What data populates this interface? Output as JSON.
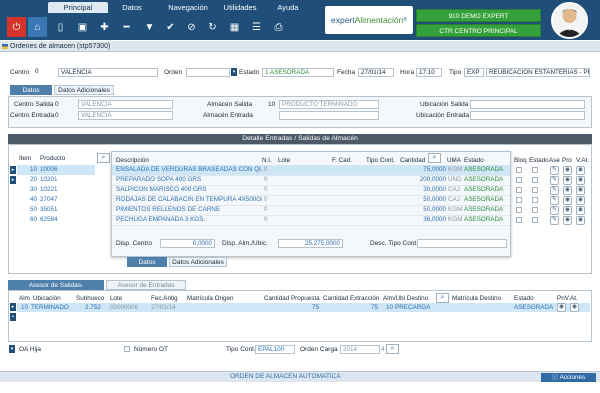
{
  "menu": {
    "tabs": [
      "Principal",
      "Datos",
      "Navegación",
      "Utilidades",
      "Ayuda"
    ],
    "active": "Principal"
  },
  "brand": {
    "name_a": "expert",
    "name_b": "Alimentación",
    "mark": "®"
  },
  "session": {
    "company": "910 DEMO EXPERT",
    "center": "CTR CENTRO PRINCIPAL"
  },
  "window_title": "Ordenes de almacen (stp57300)",
  "header": {
    "centro_label": "Centro",
    "centro_code": "0",
    "centro_name": "VALENCIA",
    "orden_label": "Orden",
    "orden_value": "",
    "estado_label": "Estado",
    "estado_code": "1",
    "estado_value": "ASESORADA",
    "fecha_label": "Fecha",
    "fecha_value": "27/01/14",
    "hora_label": "Hora",
    "hora_value": "17:10",
    "tipo_label": "Tipo",
    "tipo_code": "EXP",
    "tipo_value": "REUBICACION ESTANTERIAS - PR"
  },
  "tabs_top": [
    "Datos",
    "Datos Adicionales"
  ],
  "datos": {
    "centro_salida_label": "Centro Salida",
    "centro_salida_code": "0",
    "centro_salida_name": "VALENCIA",
    "centro_entrada_label": "Centro Entrada",
    "centro_entrada_code": "0",
    "centro_entrada_name": "VALENCIA",
    "almacen_salida_label": "Almacén Salida",
    "almacen_salida_code": "10",
    "almacen_salida_name": "PRODUCTO TERMINADO",
    "almacen_entrada_label": "Almacén Entrada",
    "almacen_entrada_code": "",
    "almacen_entrada_name": "",
    "ubic_salida_label": "Ubicación Salida",
    "ubic_entrada_label": "Ubicación Entrada"
  },
  "detalle": {
    "title": "Detalle Entradas / Salidas de Almacén",
    "columns": {
      "item": "Item",
      "producto": "Producto",
      "descripcion": "Descripción",
      "ni": "N.I.",
      "lote": "Lote",
      "fcad": "F. Cad.",
      "tipocont": "Tipo Cont.",
      "cantidad": "Cantidad",
      "uma": "UMA",
      "estado": "Estado",
      "bloq": "Bloq",
      "estado2": "Estado",
      "ase": "Ase",
      "pro": "Pro",
      "vat": "V.At."
    },
    "rows": [
      {
        "item": "10",
        "producto": "10006",
        "descripcion": "ENSALADA DE VERDURAS BRASEADAS  CON QUI",
        "ni": "0",
        "cantidad": "75,0000",
        "uma": "KGM",
        "estado": "ASESORADA"
      },
      {
        "item": "20",
        "producto": "10201",
        "descripcion": "PREPARADO SOPA 400 GRS",
        "ni": "0",
        "cantidad": "200,0000",
        "uma": "UND",
        "estado": "ASESORADA"
      },
      {
        "item": "30",
        "producto": "10221",
        "descripcion": "SALPICON MARISCO 400 GRS",
        "ni": "0",
        "cantidad": "30,0000",
        "uma": "CAJ",
        "estado": "ASESORADA"
      },
      {
        "item": "40",
        "producto": "27047",
        "descripcion": "RODAJAS DE CALABACIN EN TEMPURA 4X500GR",
        "ni": "0",
        "cantidad": "50,0000",
        "uma": "CAJ",
        "estado": "ASESORADA"
      },
      {
        "item": "50",
        "producto": "35051",
        "descripcion": "PIMIENTOS RELLENOS DE CARNE",
        "ni": "0",
        "cantidad": "50,0000",
        "uma": "KGM",
        "estado": "ASESORADA"
      },
      {
        "item": "60",
        "producto": "62584",
        "descripcion": "PECHUGA EMPANADA 3 KGS.",
        "ni": "0",
        "cantidad": "36,0000",
        "uma": "KGM",
        "estado": "ASESORADA"
      }
    ],
    "disp_centro_label": "Disp. Centro",
    "disp_centro_value": "0,0000",
    "disp_alm_label": "Disp. Alm./Ubic.",
    "disp_alm_value": "25.275,0000",
    "desc_tipo_label": "Desc. Tipo Cont."
  },
  "tabs_mid": [
    "Datos",
    "Datos Adicionales"
  ],
  "asesor": {
    "tabs": [
      "Asesor de Salidas-Reubicaciones",
      "Asesor de Entradas"
    ],
    "columns": {
      "alm": "Alm",
      "ubicacion": "Ubicación",
      "subhueco": "Subhueco",
      "lote": "Lote",
      "fec_antig": "Fec.Antig",
      "matricula_origen": "Matrícula Origen",
      "cant_prop": "Cantidad Propuesta",
      "cant_extr": "Cantidad Extracción",
      "alm_ubi_dest": "Alm/Ubi Destino",
      "matricula_dest": "Matrícula Destino",
      "estado": "Estado",
      "pnv_at": "PnV.At."
    },
    "row": {
      "alm": "10",
      "ubicacion": "TERMINADO",
      "subhueco": "2.752",
      "lote": "00000006",
      "fec_antig": "27/01/14",
      "cant_prop": "75",
      "cant_extr": "75",
      "alm_dest": "10",
      "ubi_dest": "PRECARGA",
      "estado": "ASESORADA"
    }
  },
  "footer_fields": {
    "oa_hija_label": "OA Hija",
    "numero_ot_label": "Número OT",
    "tipo_cont_label": "Tipo Cont.",
    "tipo_cont_value": "EPAL100",
    "orden_carga_label": "Orden Carga",
    "orden_carga_value": "2014",
    "orden_carga_extra": "4"
  },
  "status": {
    "message": "ORDEN DE ALMACEN AUTOMATICA",
    "acciones": "Acciones"
  },
  "colors": {
    "navy": "#1f4f78",
    "green": "#35a13a",
    "accent_blue": "#2c6fb0",
    "status_green": "#2a8a3a",
    "red": "#d6332b"
  }
}
